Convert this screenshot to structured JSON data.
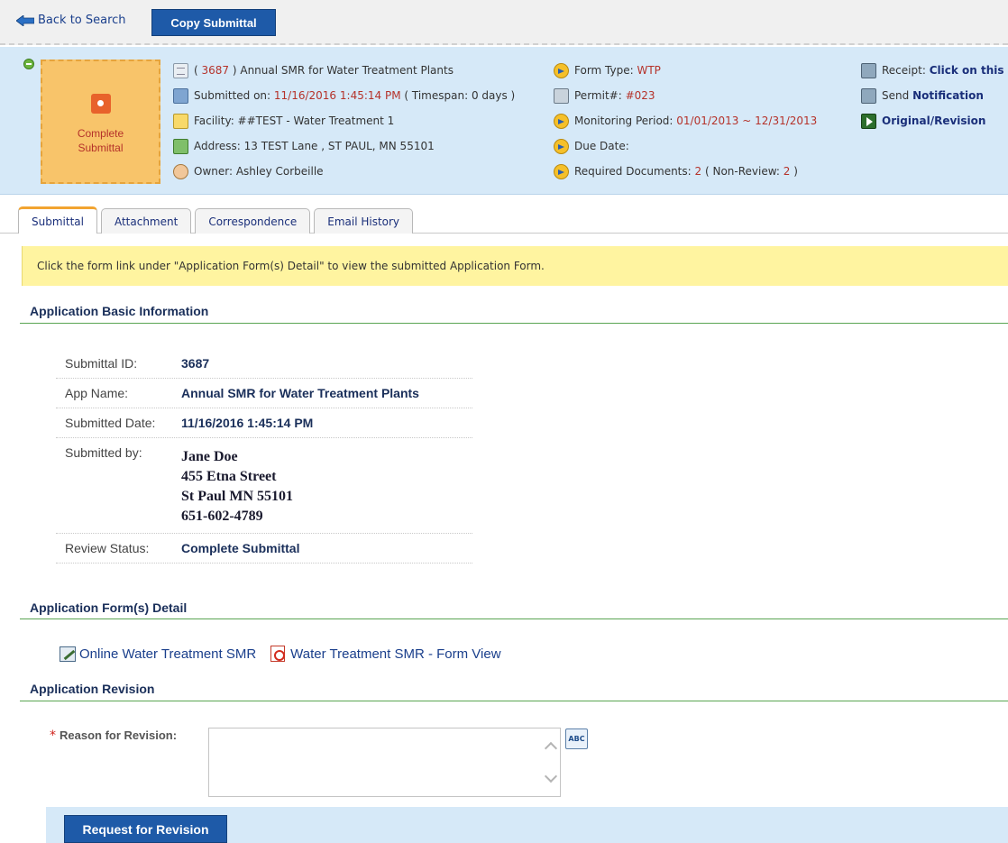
{
  "toolbar": {
    "back_label": "Back to Search",
    "copy_label": "Copy Submittal"
  },
  "status": {
    "label": "Complete Submittal"
  },
  "summary": {
    "id": "3687",
    "app_name": "Annual SMR for Water Treatment Plants",
    "submitted_on_label": "Submitted on:",
    "submitted_on": "11/16/2016 1:45:14 PM",
    "timespan": "( Timespan: 0 days )",
    "facility": "Facility: ##TEST - Water Treatment 1",
    "address": "Address: 13 TEST Lane , ST PAUL, MN 55101",
    "owner": "Owner: Ashley Corbeille",
    "form_type_label": "Form Type:",
    "form_type": "WTP",
    "permit_label": "Permit#:",
    "permit": "#023",
    "monitoring_label": "Monitoring Period:",
    "monitoring": "01/01/2013 ~ 12/31/2013",
    "due_date_label": "Due Date:",
    "required_label": "Required Documents:",
    "required_count": "2",
    "non_review_label": "( Non-Review:",
    "non_review_count": "2",
    "non_review_close": ")",
    "receipt_label": "Receipt:",
    "receipt_link": "Click on this",
    "send_label": "Send",
    "notification_link": "Notification",
    "original_link": "Original",
    "revision_link": "Revision"
  },
  "tabs": [
    {
      "label": "Submittal"
    },
    {
      "label": "Attachment"
    },
    {
      "label": "Correspondence"
    },
    {
      "label": "Email History"
    }
  ],
  "notice": "Click the form link under \"Application Form(s) Detail\" to view the submitted Application Form.",
  "sections": {
    "basic": "Application Basic Information",
    "forms": "Application Form(s) Detail",
    "revision": "Application Revision"
  },
  "basic_info": {
    "submittal_id_label": "Submittal ID:",
    "submittal_id": "3687",
    "app_name_label": "App Name:",
    "app_name": "Annual SMR for Water Treatment Plants",
    "submitted_date_label": "Submitted Date:",
    "submitted_date": "11/16/2016 1:45:14 PM",
    "submitted_by_label": "Submitted by:",
    "submitted_by": [
      "Jane Doe",
      "455 Etna Street",
      "St Paul MN 55101",
      "651-602-4789"
    ],
    "review_status_label": "Review Status:",
    "review_status": "Complete Submittal"
  },
  "forms": {
    "online": "Online Water Treatment SMR",
    "form_view": "Water Treatment SMR - Form View"
  },
  "revision": {
    "required_mark": "*",
    "reason_label": "Reason for Revision:",
    "reason_value": "",
    "button_label": "Request for Revision"
  },
  "colors": {
    "accent": "#1e5aa8",
    "info_panel": "#d6e9f8",
    "status_box": "#f8c46a",
    "notice": "#fff4a0",
    "section_line": "#5aa552",
    "highlight_red": "#b5322a"
  }
}
